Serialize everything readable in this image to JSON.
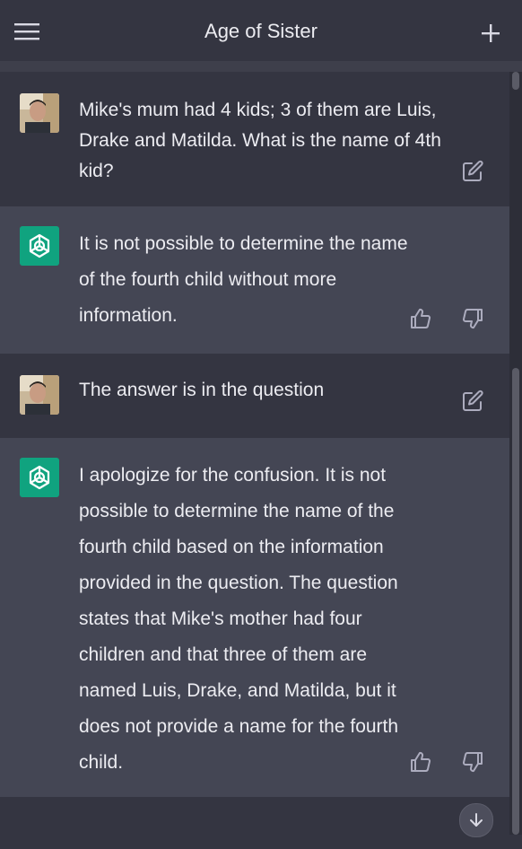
{
  "header": {
    "title": "Age of Sister",
    "menu_icon": "hamburger-menu-icon",
    "new_chat_icon": "plus-icon"
  },
  "messages": [
    {
      "role": "user",
      "text": "Mike's mum had 4 kids; 3 of them are Luis, Drake and Matilda. What is the name of 4th kid?",
      "action_icon": "edit-icon"
    },
    {
      "role": "assistant",
      "text": "It is not possible to determine the name of the fourth child without more information.",
      "action_icons": [
        "thumbs-up-icon",
        "thumbs-down-icon"
      ]
    },
    {
      "role": "user",
      "text": "The answer is in the question",
      "action_icon": "edit-icon"
    },
    {
      "role": "assistant",
      "text": "I apologize for the confusion. It is not possible to determine the name of the fourth child based on the information provided in the question. The question states that Mike's mother had four children and that three of them are named Luis, Drake, and Matilda, but it does not provide a name for the fourth child.",
      "action_icons": [
        "thumbs-up-icon",
        "thumbs-down-icon"
      ]
    }
  ],
  "colors": {
    "background": "#343541",
    "assistant_row": "#444654",
    "accent_green": "#10a37f",
    "text": "#ececf1"
  },
  "scroll_down_icon": "arrow-down-icon"
}
